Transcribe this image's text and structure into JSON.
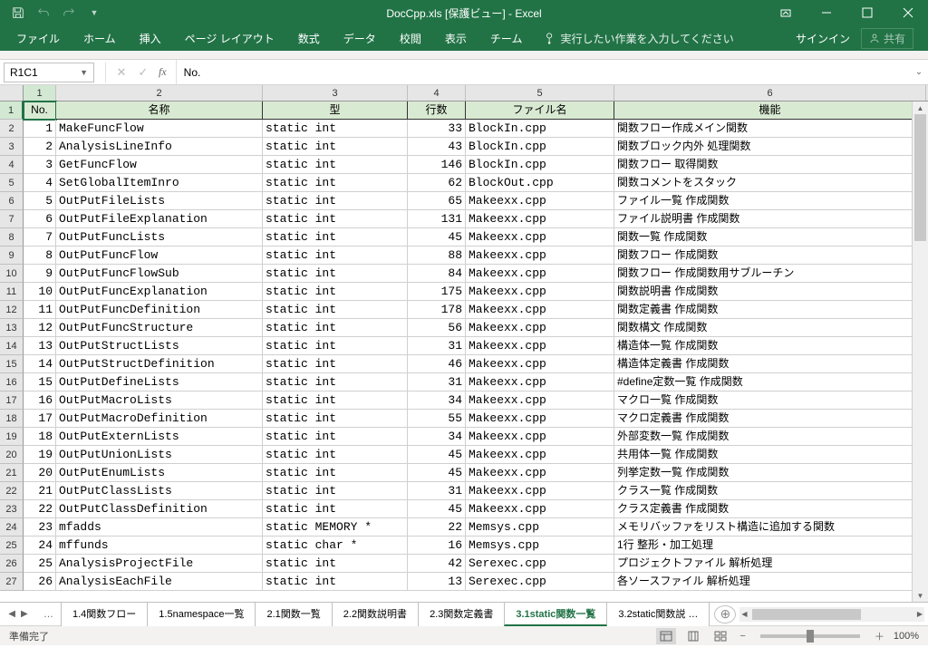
{
  "window": {
    "title": "DocCpp.xls [保護ビュー] - Excel"
  },
  "ribbon": {
    "tabs": [
      "ファイル",
      "ホーム",
      "挿入",
      "ページ レイアウト",
      "数式",
      "データ",
      "校閲",
      "表示",
      "チーム"
    ],
    "tellme": "実行したい作業を入力してください",
    "signin": "サインイン",
    "share": "共有"
  },
  "fx": {
    "namebox": "R1C1",
    "formula": "No."
  },
  "colnums": [
    "1",
    "2",
    "3",
    "4",
    "5",
    "6"
  ],
  "headers": [
    "No.",
    "名称",
    "型",
    "行数",
    "ファイル名",
    "機能"
  ],
  "rows": [
    {
      "no": "1",
      "name": "MakeFuncFlow",
      "type": "static int",
      "lines": "33",
      "file": "BlockIn.cpp",
      "desc": "関数フロー作成メイン関数"
    },
    {
      "no": "2",
      "name": "AnalysisLineInfo",
      "type": "static int",
      "lines": "43",
      "file": "BlockIn.cpp",
      "desc": "関数ブロック内外 処理関数"
    },
    {
      "no": "3",
      "name": "GetFuncFlow",
      "type": "static int",
      "lines": "146",
      "file": "BlockIn.cpp",
      "desc": "関数フロー 取得関数"
    },
    {
      "no": "4",
      "name": "SetGlobalItemInro",
      "type": "static int",
      "lines": "62",
      "file": "BlockOut.cpp",
      "desc": "関数コメントをスタック"
    },
    {
      "no": "5",
      "name": "OutPutFileLists",
      "type": "static int",
      "lines": "65",
      "file": "Makeexx.cpp",
      "desc": "ファイル一覧  作成関数"
    },
    {
      "no": "6",
      "name": "OutPutFileExplanation",
      "type": "static int",
      "lines": "131",
      "file": "Makeexx.cpp",
      "desc": "ファイル説明書  作成関数"
    },
    {
      "no": "7",
      "name": "OutPutFuncLists",
      "type": "static int",
      "lines": "45",
      "file": "Makeexx.cpp",
      "desc": "関数一覧  作成関数"
    },
    {
      "no": "8",
      "name": "OutPutFuncFlow",
      "type": "static int",
      "lines": "88",
      "file": "Makeexx.cpp",
      "desc": "関数フロー  作成関数"
    },
    {
      "no": "9",
      "name": "OutPutFuncFlowSub",
      "type": "static int",
      "lines": "84",
      "file": "Makeexx.cpp",
      "desc": "関数フロー  作成関数用サブルーチン"
    },
    {
      "no": "10",
      "name": "OutPutFuncExplanation",
      "type": "static int",
      "lines": "175",
      "file": "Makeexx.cpp",
      "desc": "関数説明書  作成関数"
    },
    {
      "no": "11",
      "name": "OutPutFuncDefinition",
      "type": "static int",
      "lines": "178",
      "file": "Makeexx.cpp",
      "desc": "関数定義書  作成関数"
    },
    {
      "no": "12",
      "name": "OutPutFuncStructure",
      "type": "static int",
      "lines": "56",
      "file": "Makeexx.cpp",
      "desc": "関数構文  作成関数"
    },
    {
      "no": "13",
      "name": "OutPutStructLists",
      "type": "static int",
      "lines": "31",
      "file": "Makeexx.cpp",
      "desc": "構造体一覧 作成関数"
    },
    {
      "no": "14",
      "name": "OutPutStructDefinition",
      "type": "static int",
      "lines": "46",
      "file": "Makeexx.cpp",
      "desc": "構造体定義書  作成関数"
    },
    {
      "no": "15",
      "name": "OutPutDefineLists",
      "type": "static int",
      "lines": "31",
      "file": "Makeexx.cpp",
      "desc": "#define定数一覧 作成関数"
    },
    {
      "no": "16",
      "name": "OutPutMacroLists",
      "type": "static int",
      "lines": "34",
      "file": "Makeexx.cpp",
      "desc": "マクロ一覧 作成関数"
    },
    {
      "no": "17",
      "name": "OutPutMacroDefinition",
      "type": "static int",
      "lines": "55",
      "file": "Makeexx.cpp",
      "desc": "マクロ定義書  作成関数"
    },
    {
      "no": "18",
      "name": "OutPutExternLists",
      "type": "static int",
      "lines": "34",
      "file": "Makeexx.cpp",
      "desc": "外部変数一覧  作成関数"
    },
    {
      "no": "19",
      "name": "OutPutUnionLists",
      "type": "static int",
      "lines": "45",
      "file": "Makeexx.cpp",
      "desc": "共用体一覧 作成関数"
    },
    {
      "no": "20",
      "name": "OutPutEnumLists",
      "type": "static int",
      "lines": "45",
      "file": "Makeexx.cpp",
      "desc": "列挙定数一覧  作成関数"
    },
    {
      "no": "21",
      "name": "OutPutClassLists",
      "type": "static int",
      "lines": "31",
      "file": "Makeexx.cpp",
      "desc": "クラス一覧 作成関数"
    },
    {
      "no": "22",
      "name": "OutPutClassDefinition",
      "type": "static int",
      "lines": "45",
      "file": "Makeexx.cpp",
      "desc": "クラス定義書  作成関数"
    },
    {
      "no": "23",
      "name": "mfadds",
      "type": "static MEMORY *",
      "lines": "22",
      "file": "Memsys.cpp",
      "desc": "メモリバッファをリスト構造に追加する関数"
    },
    {
      "no": "24",
      "name": "mffunds",
      "type": "static char *",
      "lines": "16",
      "file": "Memsys.cpp",
      "desc": "1行 整形・加工処理"
    },
    {
      "no": "25",
      "name": "AnalysisProjectFile",
      "type": "static int",
      "lines": "42",
      "file": "Serexec.cpp",
      "desc": "プロジェクトファイル  解析処理"
    },
    {
      "no": "26",
      "name": "AnalysisEachFile",
      "type": "static int",
      "lines": "13",
      "file": "Serexec.cpp",
      "desc": "各ソースファイル  解析処理"
    }
  ],
  "tabs": [
    "1.4関数フロー",
    "1.5namespace一覧",
    "2.1関数一覧",
    "2.2関数説明書",
    "2.3関数定義書",
    "3.1static関数一覧",
    "3.2static関数説 …"
  ],
  "active_tab": 5,
  "status": {
    "ready": "準備完了",
    "zoom": "100%"
  }
}
